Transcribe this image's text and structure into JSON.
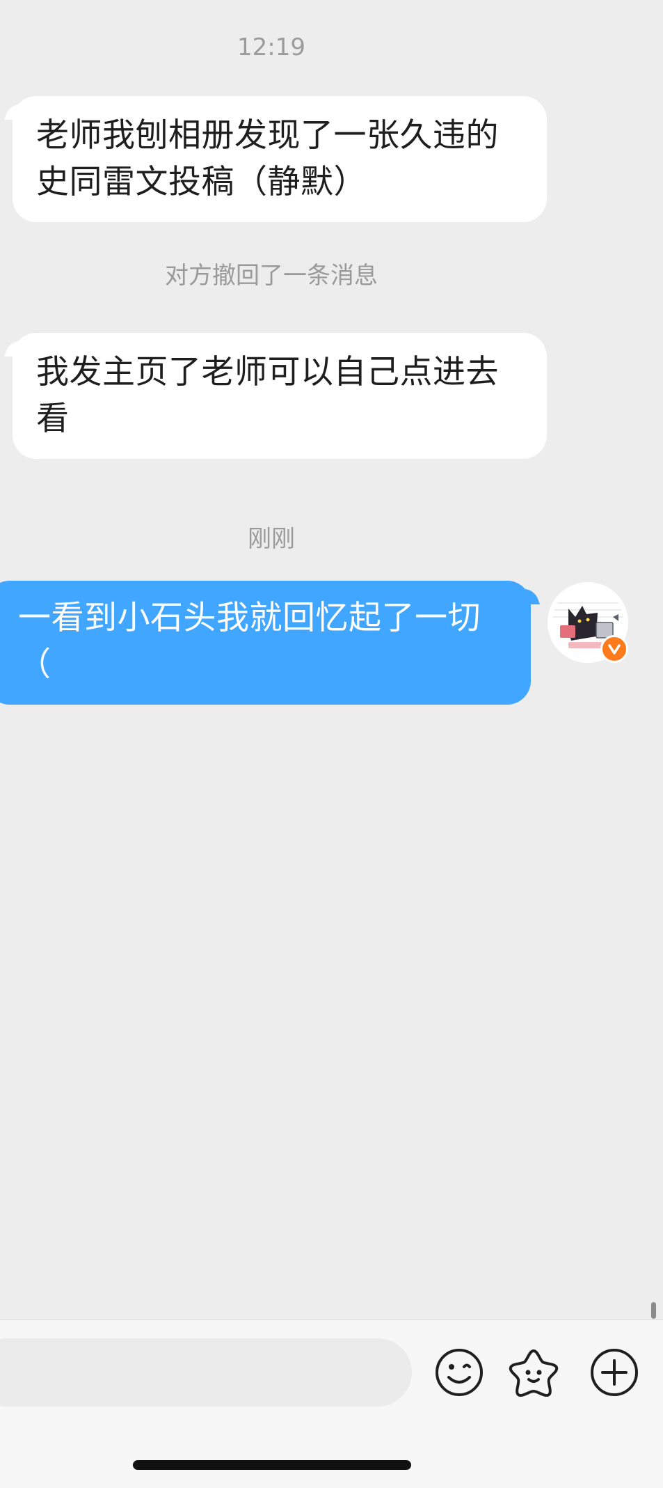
{
  "chat": {
    "timestamps": [
      "12:19",
      "刚刚"
    ],
    "messages": [
      {
        "direction": "incoming",
        "text": "老师我刨相册发现了一张久违的史同雷文投稿（静默）"
      },
      {
        "direction": "notice",
        "text": "对方撤回了一条消息"
      },
      {
        "direction": "incoming",
        "text": "我发主页了老师可以自己点进去看"
      },
      {
        "direction": "outgoing",
        "text": "一看到小石头我就回忆起了一切（"
      }
    ]
  },
  "avatar": {
    "icon": "cartoon-cat-avatar",
    "badge_icon": "verified-v-badge",
    "badge_color": "#ff7a1a"
  },
  "input_bar": {
    "placeholder": "",
    "buttons": [
      "emoji-icon",
      "sticker-icon",
      "plus-icon"
    ]
  },
  "colors": {
    "background": "#ededed",
    "incoming_bubble": "#ffffff",
    "outgoing_bubble": "#40a6ff"
  }
}
